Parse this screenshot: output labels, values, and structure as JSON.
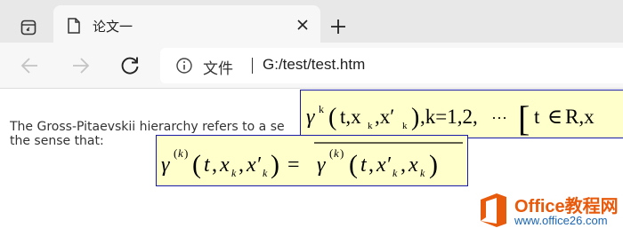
{
  "tab": {
    "title": "论文一"
  },
  "address": {
    "site_label": "文件",
    "url": "G:/test/test.htm"
  },
  "page": {
    "paragraph_line1": "The Gross-Pitaevskii hierarchy refers to a se",
    "paragraph_line2": "the sense that:"
  },
  "watermark": {
    "title": "Office教程网",
    "url": "www.office26.com"
  },
  "icons": {
    "workspaces": "workspaces-icon",
    "tab_favicon": "document-icon",
    "close": "close-icon",
    "new_tab": "plus-icon",
    "back": "back-arrow-icon",
    "forward": "forward-arrow-icon",
    "refresh": "refresh-icon",
    "info": "info-icon",
    "logo": "office-logo-icon"
  },
  "colors": {
    "equation_bg": "#ffffcc",
    "equation_border": "#1a1aa8",
    "watermark_orange": "#e85a0c",
    "watermark_blue": "#1a66b3"
  }
}
